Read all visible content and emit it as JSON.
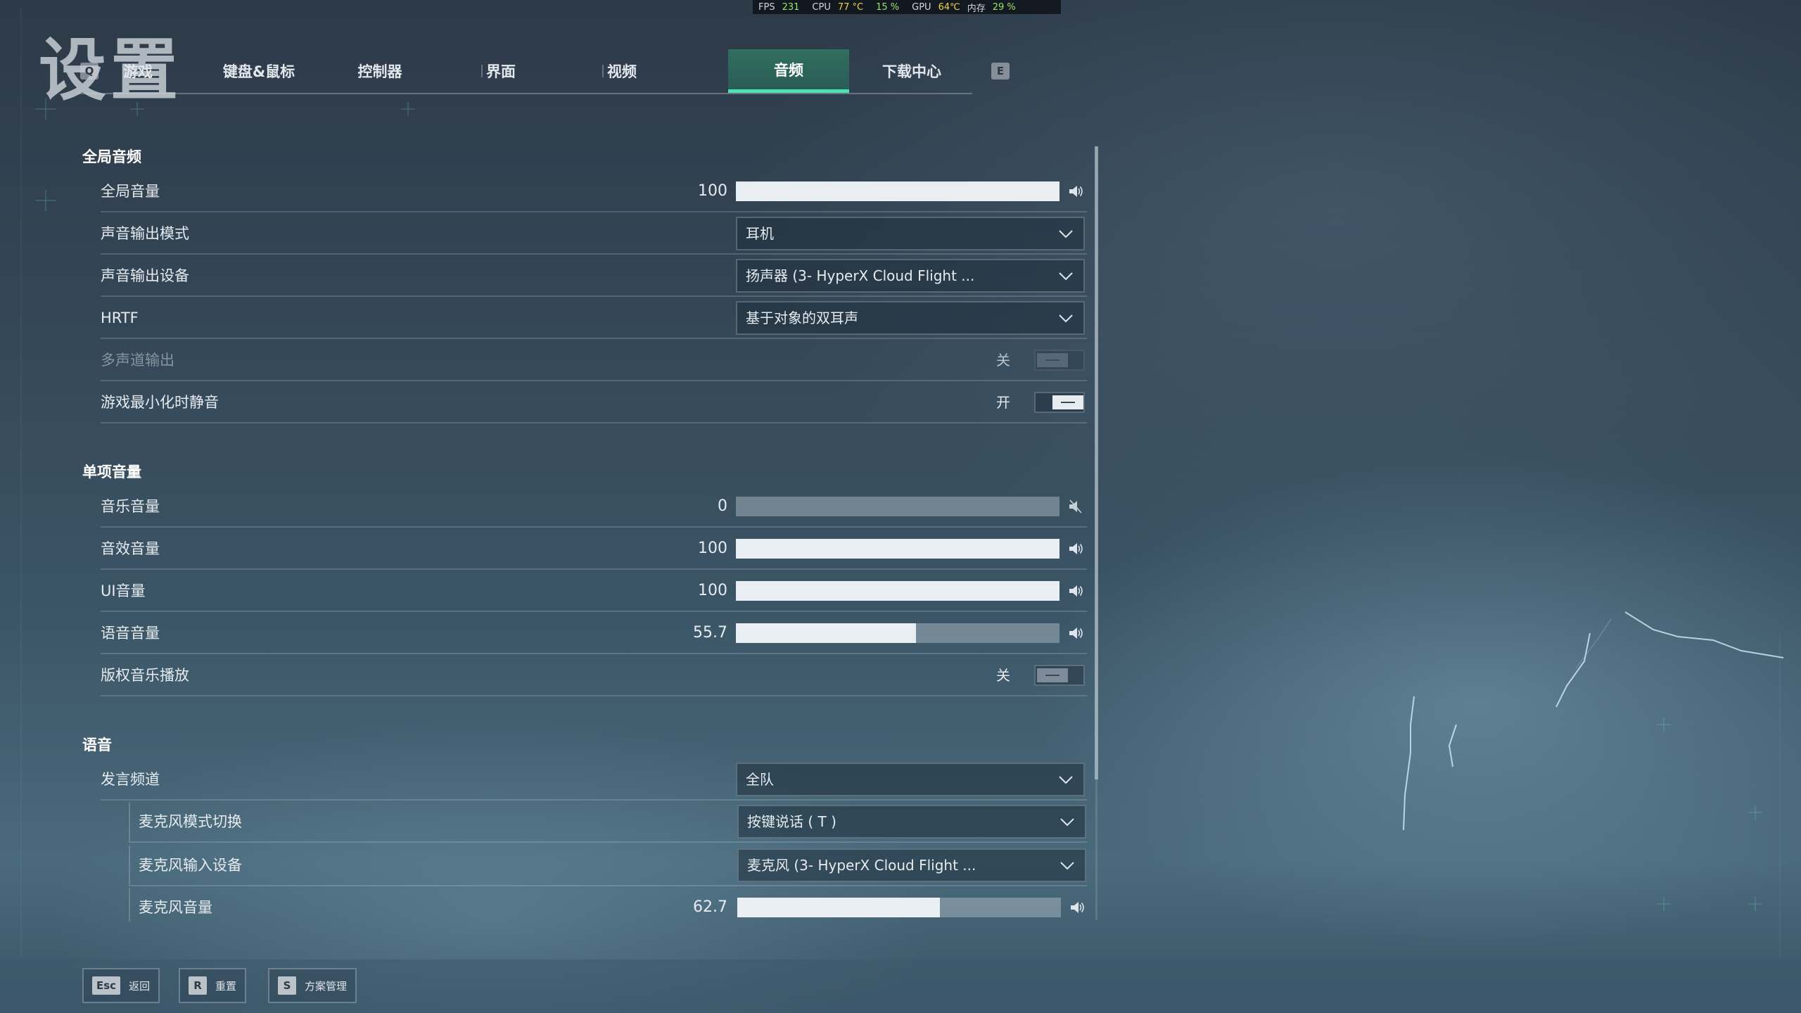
{
  "window": {
    "title": "设置"
  },
  "perf": {
    "fps_label": "FPS",
    "fps_value": "231",
    "cpu_label": "CPU",
    "cpu_temp": "77 °C",
    "cpu_usage": "15 %",
    "gpu_label": "GPU",
    "gpu_temp": "64℃",
    "mem_label": "内存",
    "mem_usage": "29 %"
  },
  "tabs": {
    "prev_key": "Q",
    "next_key": "E",
    "items": [
      {
        "label": "游戏"
      },
      {
        "label": "键盘&鼠标"
      },
      {
        "label": "控制器"
      },
      {
        "label": "界面"
      },
      {
        "label": "视频"
      },
      {
        "label": "音频",
        "active": true
      },
      {
        "label": "下载中心"
      }
    ]
  },
  "sections": {
    "global_audio": {
      "title": "全局音频",
      "master_volume": {
        "label": "全局音量",
        "value": "100",
        "level": 1.0
      },
      "output_mode": {
        "label": "声音输出模式",
        "selected": "耳机"
      },
      "output_device": {
        "label": "声音输出设备",
        "selected": "扬声器 (3- HyperX Cloud Flight ..."
      },
      "hrtf": {
        "label": "HRTF",
        "selected": "基于对象的双耳声"
      },
      "multichannel": {
        "label": "多声道输出",
        "state": "关"
      },
      "mute_minimized": {
        "label": "游戏最小化时静音",
        "state": "开"
      }
    },
    "individual_volume": {
      "title": "单项音量",
      "music": {
        "label": "音乐音量",
        "value": "0",
        "level": 0.0
      },
      "sfx": {
        "label": "音效音量",
        "value": "100",
        "level": 1.0
      },
      "ui": {
        "label": "UI音量",
        "value": "100",
        "level": 1.0
      },
      "voice": {
        "label": "语音音量",
        "value": "55.7",
        "level": 0.557
      },
      "licensed_music": {
        "label": "版权音乐播放",
        "state": "关"
      }
    },
    "voice": {
      "title": "语音",
      "channel": {
        "label": "发言频道",
        "selected": "全队"
      },
      "mic_mode": {
        "label": "麦克风模式切换",
        "selected": "按键说话 ( T )"
      },
      "mic_device": {
        "label": "麦克风输入设备",
        "selected": "麦克风 (3- HyperX Cloud Flight ..."
      },
      "mic_volume": {
        "label": "麦克风音量",
        "value": "62.7",
        "level": 0.627
      }
    }
  },
  "bottom_bar": {
    "back": {
      "key": "Esc",
      "label": "返回"
    },
    "reset": {
      "key": "R",
      "label": "重置"
    },
    "presets": {
      "key": "S",
      "label": "方案管理"
    }
  },
  "colors": {
    "accent": "#4fe0b4",
    "active_tab_bg": "#2f6e60",
    "perf_green": "#9be36a",
    "perf_yellow": "#f1d34a"
  },
  "icons": {
    "volume": "speaker-icon",
    "muted": "speaker-muted-icon",
    "chevron": "chevron-down-icon"
  }
}
